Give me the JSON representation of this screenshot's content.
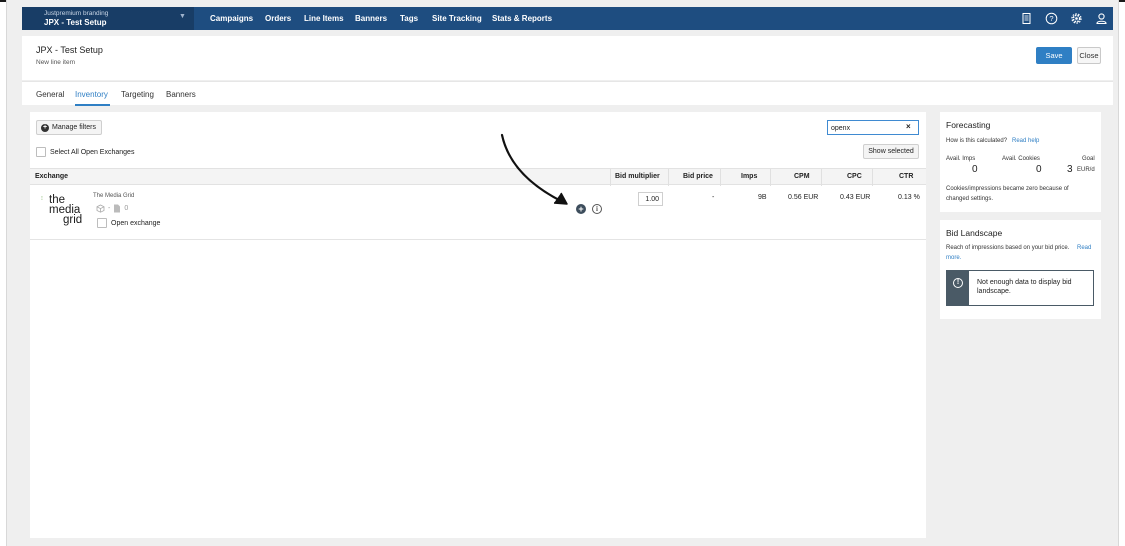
{
  "nav": {
    "brand_small": "Justpremium branding",
    "brand_main": "JPX - Test Setup",
    "items": [
      "Campaigns",
      "Orders",
      "Line Items",
      "Banners",
      "Tags",
      "Site Tracking",
      "Stats & Reports"
    ],
    "icons": [
      "document-icon",
      "help-icon",
      "gear-icon",
      "user-icon"
    ]
  },
  "header": {
    "title": "JPX - Test Setup",
    "subtitle": "New line item",
    "save_label": "Save",
    "close_label": "Close"
  },
  "tabs": [
    {
      "label": "General"
    },
    {
      "label": "Inventory",
      "active": true
    },
    {
      "label": "Targeting"
    },
    {
      "label": "Banners"
    }
  ],
  "filters": {
    "manage_label": "Manage filters",
    "search_value": "openx",
    "select_all_label": "Select All Open Exchanges",
    "show_selected_label": "Show selected"
  },
  "table": {
    "columns": [
      "Exchange",
      "Bid multiplier",
      "Bid price",
      "Imps",
      "CPM",
      "CPC",
      "CTR"
    ],
    "rows": [
      {
        "logo_lines": [
          "the",
          "media",
          "grid"
        ],
        "name": "The Media Grid",
        "meta_dash": "-",
        "meta_count": "0",
        "type_label": "Open exchange",
        "bid_multiplier": "1.00",
        "bid_price": "-",
        "imps": "9B",
        "cpm": "0.56 EUR",
        "cpc": "0.43 EUR",
        "ctr": "0.13 %"
      }
    ]
  },
  "forecasting": {
    "title": "Forecasting",
    "how_text": "How is this calculated?",
    "read_help": "Read help",
    "avail_imps_label": "Avail. Imps",
    "avail_imps_value": "0",
    "avail_cookies_label": "Avail. Cookies",
    "avail_cookies_value": "0",
    "goal_label": "Goal",
    "goal_value": "3",
    "goal_unit": "EUR/d",
    "note_line1": "Cookies/impressions became zero because of",
    "note_line2": "changed settings."
  },
  "bid_landscape": {
    "title": "Bid Landscape",
    "desc_line1": "Reach of impressions based on your bid price.",
    "read_more_1": "Read",
    "read_more_2": "more.",
    "warning": "Not enough data to display bid landscape."
  },
  "colors": {
    "nav_bg": "#1e4d80",
    "accent": "#2f7fc4"
  }
}
